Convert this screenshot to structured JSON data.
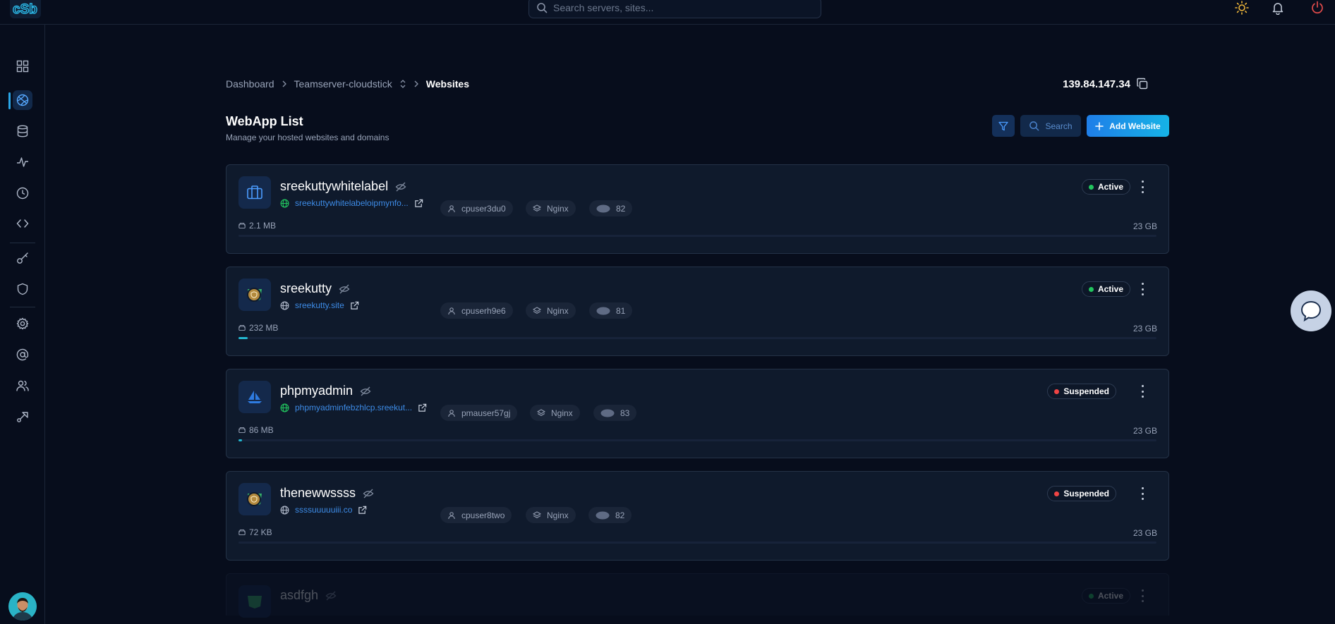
{
  "topbar": {
    "logo_text": "cSb",
    "search_placeholder": "Search servers, sites..."
  },
  "breadcrumb": {
    "items": [
      "Dashboard",
      "Teamserver-cloudstick",
      "Websites"
    ]
  },
  "server": {
    "ip": "139.84.147.34"
  },
  "page": {
    "title": "WebApp List",
    "subtitle": "Manage your hosted websites and domains"
  },
  "toolbar": {
    "search_label": "Search",
    "add_label": "Add Website"
  },
  "colors": {
    "active": "#22c55e",
    "suspended": "#ef4444",
    "accent": "#1f7ee8"
  },
  "webapps": [
    {
      "name": "sreekuttywhitelabel",
      "domain": "sreekuttywhitelabeloipmynfo...",
      "user": "cpuser3du0",
      "stack": "Nginx",
      "php": "82",
      "size": "2.1 MB",
      "quota": "23 GB",
      "status": "Active",
      "usage_fraction": 0.0
    },
    {
      "name": "sreekutty",
      "domain": "sreekutty.site",
      "user": "cpuserh9e6",
      "stack": "Nginx",
      "php": "81",
      "size": "232 MB",
      "quota": "23 GB",
      "status": "Active",
      "usage_fraction": 0.01
    },
    {
      "name": "phpmyadmin",
      "domain": "phpmyadminfebzhlcp.sreekut...",
      "user": "pmauser57gj",
      "stack": "Nginx",
      "php": "83",
      "size": "86 MB",
      "quota": "23 GB",
      "status": "Suspended",
      "usage_fraction": 0.004
    },
    {
      "name": "thenewwssss",
      "domain": "ssssuuuuuiii.co",
      "user": "cpuser8two",
      "stack": "Nginx",
      "php": "82",
      "size": "72 KB",
      "quota": "23 GB",
      "status": "Suspended",
      "usage_fraction": 0.0
    },
    {
      "name": "asdfgh",
      "status": "Active"
    }
  ]
}
